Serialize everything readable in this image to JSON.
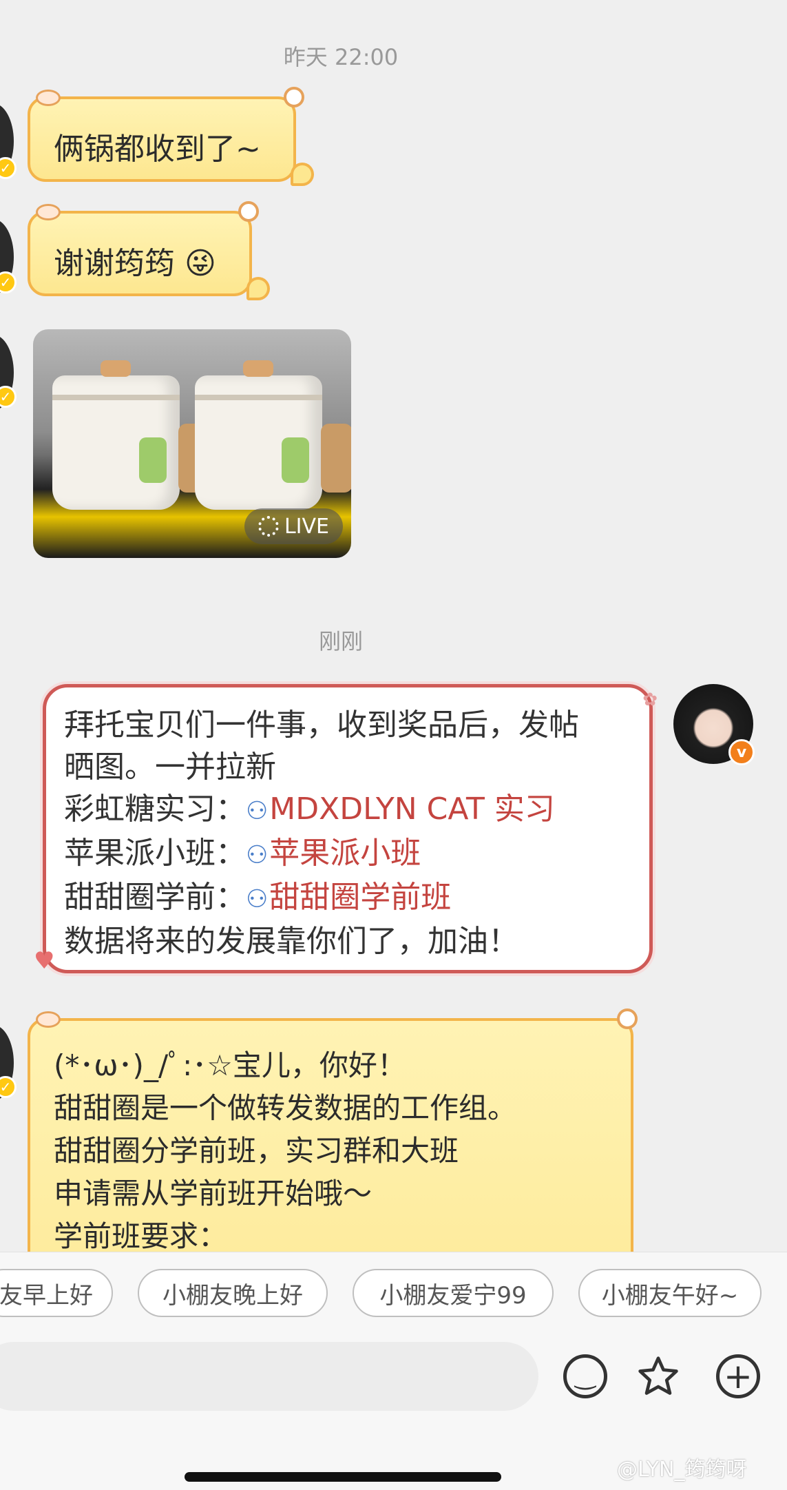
{
  "timestamps": {
    "first": "昨天 22:00",
    "second": "刚刚"
  },
  "messages": {
    "m1": "俩锅都收到了~",
    "m2": "谢谢筠筠",
    "m2_emoji": "😜",
    "m3_live_label": "LIVE",
    "m4_lines": {
      "l1": "拜托宝贝们一件事，收到奖品后，发帖",
      "l2": "晒图。一并拉新",
      "l3_label": "彩虹糖实习：",
      "l3_link": "MDXDLYN  CAT 实习",
      "l4_label": "苹果派小班：",
      "l4_link": "苹果派小班",
      "l5_label": "甜甜圈学前：",
      "l5_link": "甜甜圈学前班",
      "l6": "数据将来的发展靠你们了，加油！"
    },
    "m5_lines": {
      "l1": "(*･ω･)_/ﾟ:･☆宝儿，你好！",
      "l2": "甜甜圈是一个做转发数据的工作组。",
      "l3": "甜甜圈分学前班，实习群和大班",
      "l4": "申请需从学前班开始哦～",
      "l5": "学前班要求："
    }
  },
  "quick_replies": [
    "友早上好",
    "小棚友晚上好",
    "小棚友爱宁99",
    "小棚友午好~"
  ],
  "toolbar": {
    "emoji_icon": "smiley-icon",
    "sticker_icon": "star-icon",
    "more_icon": "plus-icon"
  },
  "watermark": "@LYN_筠筠呀",
  "colors": {
    "yellow_bubble": "#fde790",
    "yellow_border": "#f3b44a",
    "red_border": "#cf5a57",
    "link_red": "#c4443f",
    "group_icon_blue": "#4a7ec9",
    "verify_badge": "#ffc812",
    "avatar_badge": "#f27f1b"
  }
}
